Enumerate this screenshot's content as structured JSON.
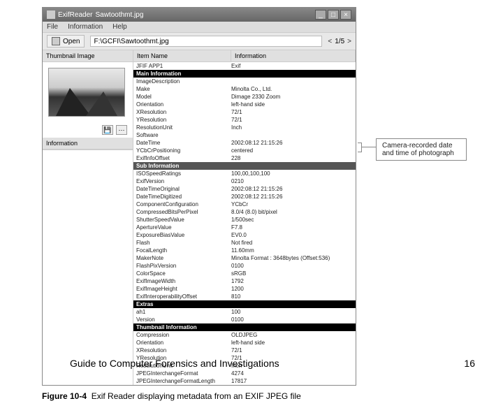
{
  "window": {
    "title_app": "ExifReader",
    "title_file": "Sawtoothmt.jpg",
    "min": "_",
    "max": "□",
    "close": "×"
  },
  "menu": {
    "file": "File",
    "info": "Information",
    "help": "Help"
  },
  "toolbar": {
    "open": "Open",
    "path": "F:\\GCFI\\Sawtoothmt.jpg",
    "nav_prev": "<",
    "page": "1/5",
    "nav_next": ">"
  },
  "left": {
    "thumb_header": "Thumbnail Image",
    "save_icon": "💾",
    "detail_icon": "⋯",
    "info_header": "Information"
  },
  "cols": {
    "name": "Item Name",
    "info": "Information"
  },
  "sections": {
    "jfif": "JFIF APP1",
    "main": "Main Information",
    "sub": "Sub Information",
    "extras": "Extras",
    "thumb": "Thumbnail Information"
  },
  "exif_label": "Exif",
  "main_rows": [
    {
      "k": "ImageDescription",
      "v": ""
    },
    {
      "k": "Make",
      "v": "Minolta Co., Ltd."
    },
    {
      "k": "Model",
      "v": "Dimage 2330 Zoom"
    },
    {
      "k": "Orientation",
      "v": "left-hand side"
    },
    {
      "k": "XResolution",
      "v": "72/1"
    },
    {
      "k": "YResolution",
      "v": "72/1"
    },
    {
      "k": "ResolutionUnit",
      "v": "Inch"
    },
    {
      "k": "Software",
      "v": ""
    },
    {
      "k": "DateTime",
      "v": "2002:08:12 21:15:26"
    },
    {
      "k": "YCbCrPositioning",
      "v": "centered"
    },
    {
      "k": "ExifInfoOffset",
      "v": "228"
    }
  ],
  "sub_rows": [
    {
      "k": "ISOSpeedRatings",
      "v": "100,00,100,100"
    },
    {
      "k": "ExifVersion",
      "v": "0210"
    },
    {
      "k": "DateTimeOriginal",
      "v": "2002:08:12 21:15:26"
    },
    {
      "k": "DateTimeDigitized",
      "v": "2002:08:12 21:15:26"
    },
    {
      "k": "ComponentConfiguration",
      "v": "YCbCr"
    },
    {
      "k": "CompressedBitsPerPixel",
      "v": "8.0/4 (8.0) bit/pixel"
    },
    {
      "k": "ShutterSpeedValue",
      "v": "1/500sec"
    },
    {
      "k": "ApertureValue",
      "v": "F7.8"
    },
    {
      "k": "ExposureBiasValue",
      "v": "EV0.0"
    },
    {
      "k": "Flash",
      "v": "Not fired"
    },
    {
      "k": "FocalLength",
      "v": "11.60mm"
    },
    {
      "k": "MakerNote",
      "v": "Minolta Format : 3648bytes (Offset:536)"
    },
    {
      "k": "FlashPixVersion",
      "v": "0100"
    },
    {
      "k": "ColorSpace",
      "v": "sRGB"
    },
    {
      "k": "ExifImageWidth",
      "v": "1792"
    },
    {
      "k": "ExifImageHeight",
      "v": "1200"
    },
    {
      "k": "ExifInteroperabilityOffset",
      "v": "810"
    }
  ],
  "extras_rows": [
    {
      "k": "ah1",
      "v": "100"
    },
    {
      "k": "Version",
      "v": "0100"
    }
  ],
  "thumb_rows": [
    {
      "k": "Compression",
      "v": "OLDJPEG"
    },
    {
      "k": "Orientation",
      "v": "left-hand side"
    },
    {
      "k": "XResolution",
      "v": "72/1"
    },
    {
      "k": "YResolution",
      "v": "72/1"
    },
    {
      "k": "ResolutionUnit",
      "v": "Inch"
    },
    {
      "k": "JPEGInterchangeFormat",
      "v": "4274"
    },
    {
      "k": "JPEGInterchangeFormatLength",
      "v": "17817"
    }
  ],
  "callout": "Camera-recorded date and time of photograph",
  "figure": {
    "num": "Figure 10-4",
    "caption": "Exif Reader displaying metadata from an EXIF JPEG file"
  },
  "footer": {
    "text": "Guide to Computer Forensics and Investigations",
    "page": "16"
  }
}
